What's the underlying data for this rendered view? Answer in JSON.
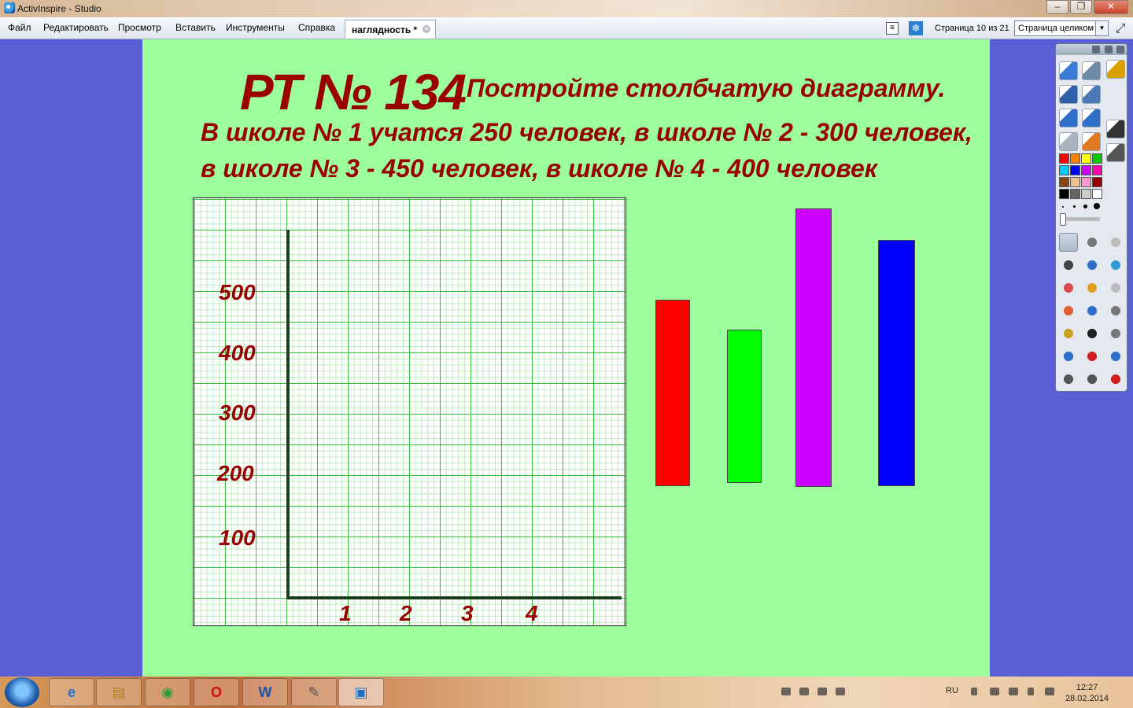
{
  "window": {
    "title": "ActivInspire - Studio"
  },
  "menu": [
    "Файл",
    "Редактировать",
    "Просмотр",
    "Вставить",
    "Инструменты",
    "Справка"
  ],
  "tab": {
    "label": "наглядность *"
  },
  "status": {
    "page": "Страница 10 из 21",
    "zoom": "Страница целиком"
  },
  "slide": {
    "task_number": "РТ № 134",
    "task_heading": "Постройте столбчатую диаграмму.",
    "line1": "В школе № 1 учатся 250 человек, в школе № 2 - 300 человек,",
    "line2": "в школе № 3 - 450 человек, в школе № 4 - 400 человек",
    "y_ticks": [
      "500",
      "400",
      "300",
      "200",
      "100"
    ],
    "x_ticks": [
      "1",
      "2",
      "3",
      "4"
    ]
  },
  "bar_colors": [
    "#ff0000",
    "#00ff00",
    "#cc00ff",
    "#0000ff"
  ],
  "toolbox_colors": [
    "#ff0000",
    "#ff8000",
    "#ffff00",
    "#00cc00",
    "#00ccff",
    "#0000ff",
    "#cc00ff",
    "#ff00aa",
    "#8b4513",
    "#f0c090",
    "#ff99cc",
    "#990000",
    "#000000",
    "#666666",
    "#cccccc",
    "#ffffff"
  ],
  "taskbar": {
    "apps": [
      "internet-explorer",
      "file-explorer",
      "chrome",
      "opera",
      "word",
      "tools",
      "activinspire"
    ],
    "lang": "RU",
    "time": "12:27",
    "date": "28.02.2014"
  }
}
